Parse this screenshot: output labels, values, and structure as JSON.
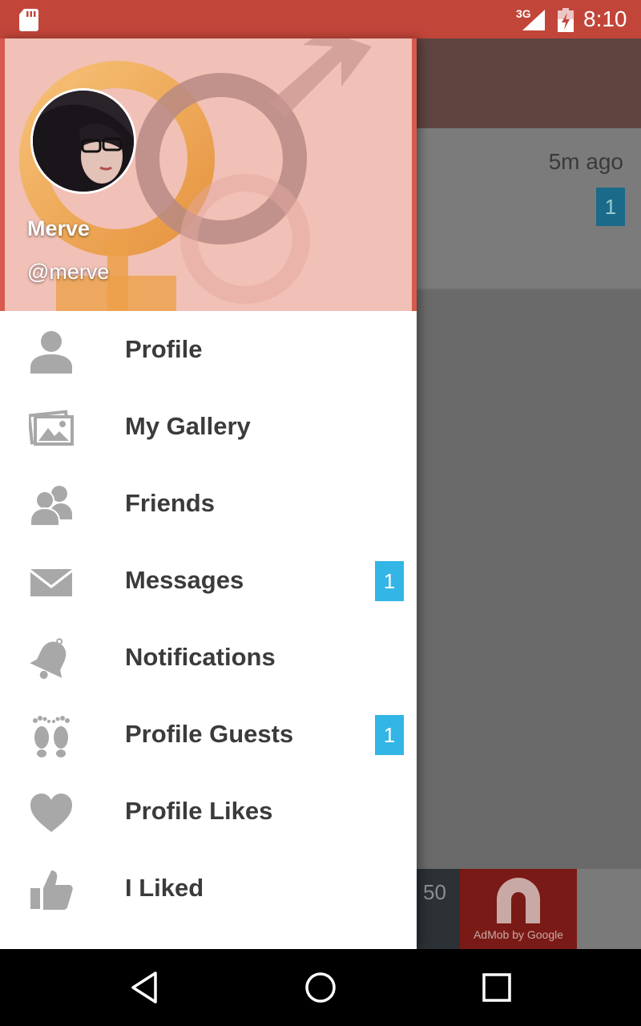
{
  "status_bar": {
    "network": "3G",
    "time": "8:10"
  },
  "background": {
    "row_time": "5m ago",
    "row_badge": "1",
    "ad_partial_number": "50",
    "ad_text": "AdMob by Google"
  },
  "drawer": {
    "user": {
      "name": "Merve",
      "handle": "@merve"
    },
    "menu": [
      {
        "label": "Profile",
        "icon": "person-icon",
        "badge": null
      },
      {
        "label": "My Gallery",
        "icon": "gallery-icon",
        "badge": null
      },
      {
        "label": "Friends",
        "icon": "friends-icon",
        "badge": null
      },
      {
        "label": "Messages",
        "icon": "envelope-icon",
        "badge": "1"
      },
      {
        "label": "Notifications",
        "icon": "bell-icon",
        "badge": null
      },
      {
        "label": "Profile Guests",
        "icon": "footprints-icon",
        "badge": "1"
      },
      {
        "label": "Profile Likes",
        "icon": "heart-icon",
        "badge": null
      },
      {
        "label": "I Liked",
        "icon": "thumbs-up-icon",
        "badge": null
      }
    ]
  },
  "colors": {
    "status_bar": "#c2453a",
    "badge": "#33b5e5",
    "menu_text": "#3b3b3b",
    "icon": "#a8a8a8"
  }
}
